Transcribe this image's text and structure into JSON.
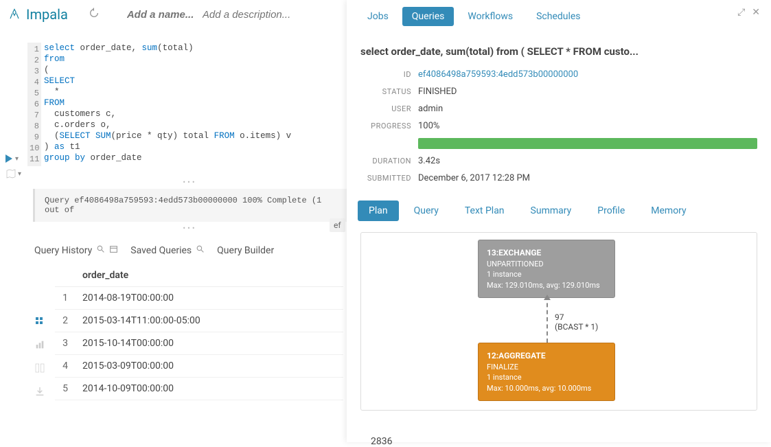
{
  "app": {
    "title": "Impala",
    "name_placeholder": "Add a name...",
    "desc_placeholder": "Add a description..."
  },
  "editor": {
    "lines": [
      {
        "n": 1,
        "html": "<span class='kw'>select</span> order_date, <span class='kw'>sum</span>(total)"
      },
      {
        "n": 2,
        "html": "<span class='kw'>from</span>"
      },
      {
        "n": 3,
        "html": "("
      },
      {
        "n": 4,
        "html": "<span class='kw'>SELECT</span>"
      },
      {
        "n": 5,
        "html": "  *"
      },
      {
        "n": 6,
        "html": "<span class='kw'>FROM</span>"
      },
      {
        "n": 7,
        "html": "  customers c,"
      },
      {
        "n": 8,
        "html": "  c.orders o,"
      },
      {
        "n": 9,
        "html": "  (<span class='kw'>SELECT SUM</span>(price * qty) total <span class='kw'>FROM</span> o.items) v"
      },
      {
        "n": 10,
        "html": ") <span class='kw'>as</span> t1"
      },
      {
        "n": 11,
        "html": "<span class='kw'>group by</span> order_date"
      }
    ]
  },
  "status_line": "Query ef4086498a759593:4edd573b00000000 100% Complete (1 out of",
  "chip": "ef",
  "lower_tabs": {
    "history": "Query History",
    "saved": "Saved Queries",
    "builder": "Query Builder"
  },
  "results": {
    "header": "order_date",
    "rows": [
      {
        "i": 1,
        "v": "2014-08-19T00:00:00"
      },
      {
        "i": 2,
        "v": "2015-03-14T11:00:00-05:00"
      },
      {
        "i": 3,
        "v": "2015-10-14T00:00:00"
      },
      {
        "i": 4,
        "v": "2015-03-09T00:00:00"
      },
      {
        "i": 5,
        "v": "2014-10-09T00:00:00"
      }
    ],
    "count": "2836"
  },
  "right": {
    "tabs": {
      "jobs": "Jobs",
      "queries": "Queries",
      "workflows": "Workflows",
      "schedules": "Schedules"
    },
    "title": "select order_date, sum(total) from ( SELECT * FROM custo...",
    "meta": {
      "id_label": "ID",
      "id": "ef4086498a759593:4edd573b00000000",
      "status_label": "STATUS",
      "status": "FINISHED",
      "user_label": "USER",
      "user": "admin",
      "progress_label": "PROGRESS",
      "progress": "100%",
      "duration_label": "DURATION",
      "duration": "3.42s",
      "submitted_label": "SUBMITTED",
      "submitted": "December 6, 2017 12:28 PM"
    },
    "subtabs": {
      "plan": "Plan",
      "query": "Query",
      "textplan": "Text Plan",
      "summary": "Summary",
      "profile": "Profile",
      "memory": "Memory"
    },
    "plan": {
      "nodeA": {
        "title": "13:EXCHANGE",
        "sub": "UNPARTITIONED",
        "inst": "1 instance",
        "stat": "Max: 129.010ms, avg: 129.010ms"
      },
      "edge": {
        "count": "97",
        "mode": "(BCAST * 1)"
      },
      "nodeB": {
        "title": "12:AGGREGATE",
        "sub": "FINALIZE",
        "inst": "1 instance",
        "stat": "Max: 10.000ms, avg: 10.000ms"
      }
    }
  }
}
